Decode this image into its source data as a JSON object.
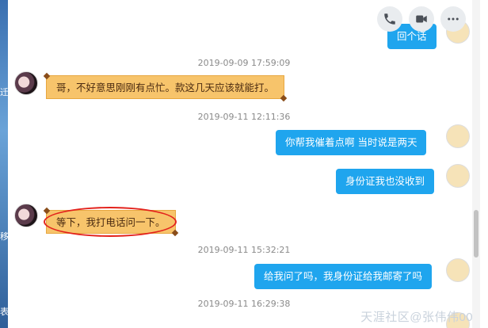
{
  "desktop": {
    "glyphs": [
      "迁",
      "移",
      "表"
    ]
  },
  "toolbar": {
    "call_icon": "phone-icon",
    "video_icon": "video-icon",
    "more_icon": "more-icon"
  },
  "messages": {
    "partial_top": "回个话",
    "ts1": "2019-09-09 17:59:09",
    "msg1": "哥，不好意思刚刚有点忙。款这几天应该就能打。",
    "ts2": "2019-09-11 12:11:36",
    "msg2": "你帮我催着点啊   当时说是两天",
    "msg3": "身份证我也没收到",
    "msg4": "等下，我打电话问一下。",
    "ts3": "2019-09-11 15:32:21",
    "msg5": "给我问了吗，我身份证给我邮寄了吗",
    "ts4": "2019-09-11 16:29:38"
  },
  "watermark": "天涯社区@张伟伟001",
  "colors": {
    "outgoing": "#1fa5ee",
    "incoming": "#f7c46b",
    "highlight": "#e3221c"
  }
}
